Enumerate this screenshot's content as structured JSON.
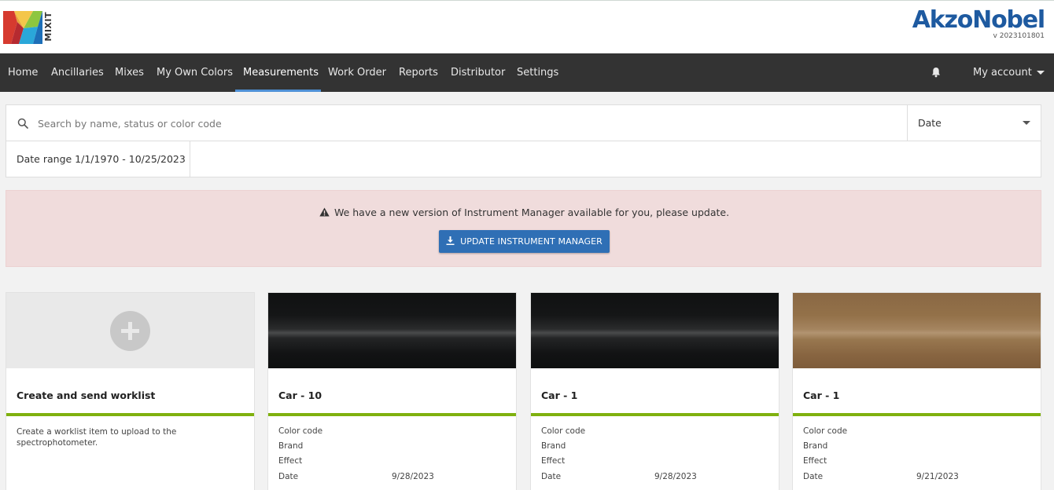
{
  "brand": {
    "logo_text": "MIXIT",
    "company": "AkzoNobel",
    "version": "v 2023101801"
  },
  "nav": {
    "items": [
      {
        "label": "Home",
        "active": false
      },
      {
        "label": "Ancillaries",
        "active": false
      },
      {
        "label": "Mixes",
        "active": false
      },
      {
        "label": "My Own Colors",
        "active": false
      },
      {
        "label": "Measurements",
        "active": true
      },
      {
        "label": "Work Order",
        "active": false
      },
      {
        "label": "Reports",
        "active": false
      },
      {
        "label": "Distributor",
        "active": false
      },
      {
        "label": "Settings",
        "active": false
      }
    ],
    "bell_icon": "bell-icon",
    "account_label": "My account"
  },
  "search": {
    "placeholder": "Search by name, status or color code",
    "value": "",
    "sort_selected": "Date",
    "date_range": "Date range 1/1/1970 - 10/25/2023"
  },
  "alert": {
    "message": "We have a new version of Instrument Manager available for you, please update.",
    "button_label": "UPDATE INSTRUMENT MANAGER"
  },
  "cards": {
    "create": {
      "title": "Create and send worklist",
      "description": "Create a worklist item to upload to the spectrophotometer."
    },
    "items": [
      {
        "title": "Car - 10",
        "color_code_label": "Color code",
        "brand_label": "Brand",
        "effect_label": "Effect",
        "date_label": "Date",
        "date_value": "9/28/2023",
        "swatch": "#151617"
      },
      {
        "title": "Car - 1",
        "color_code_label": "Color code",
        "brand_label": "Brand",
        "effect_label": "Effect",
        "date_label": "Date",
        "date_value": "9/28/2023",
        "swatch": "#151617"
      },
      {
        "title": "Car - 1",
        "color_code_label": "Color code",
        "brand_label": "Brand",
        "effect_label": "Effect",
        "date_label": "Date",
        "date_value": "9/21/2023",
        "swatch": "#8d6944"
      }
    ]
  },
  "colors": {
    "accent_green": "#7fb10f",
    "nav_bg": "#333333",
    "button_blue": "#2f6fb5",
    "alert_bg": "#f0dcdc"
  }
}
